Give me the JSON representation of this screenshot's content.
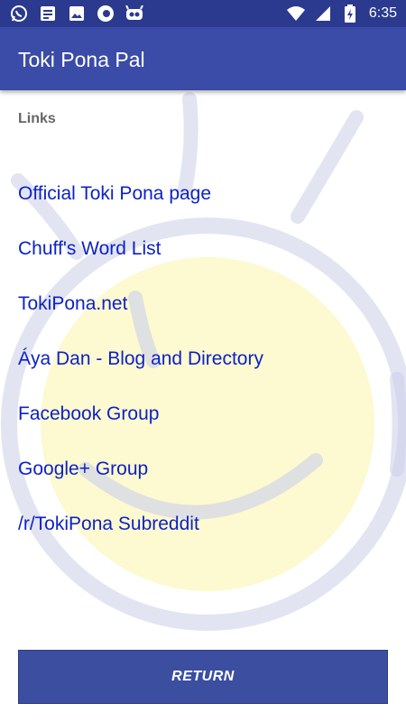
{
  "status_bar": {
    "left_icons": [
      "whatsapp-icon",
      "document-icon",
      "image-icon",
      "firefox-icon",
      "robot-icon"
    ],
    "right_icons": [
      "wifi-icon",
      "signal-icon",
      "battery-icon"
    ],
    "time": "6:35"
  },
  "app_bar": {
    "title": "Toki Pona Pal"
  },
  "section": {
    "header": "Links"
  },
  "links": [
    {
      "label": "Official Toki Pona page"
    },
    {
      "label": "Chuff's Word List"
    },
    {
      "label": "TokiPona.net"
    },
    {
      "label": "Áya Dan - Blog and Directory"
    },
    {
      "label": "Facebook Group"
    },
    {
      "label": "Google+ Group"
    },
    {
      "label": "/r/TokiPona Subreddit"
    }
  ],
  "return_button": {
    "label": "RETURN"
  },
  "colors": {
    "status_bar": "#2b3a8f",
    "app_bar": "#3a4ca8",
    "link": "#0d22c6",
    "button": "#3b4ea0",
    "sun_fill": "#fdf7c0",
    "sun_stroke": "#c8cbe6"
  }
}
